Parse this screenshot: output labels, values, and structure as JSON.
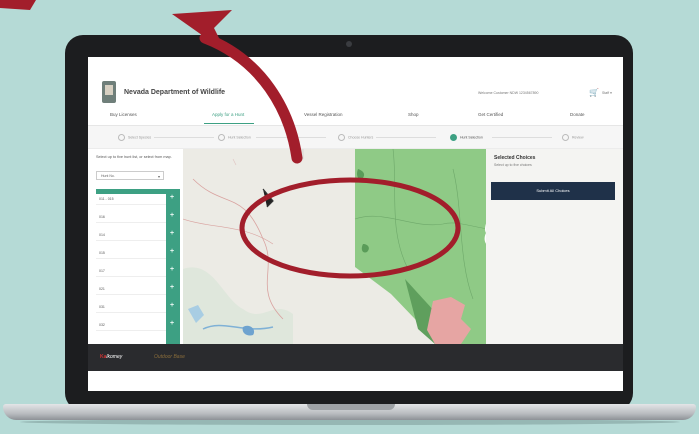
{
  "app": {
    "brand": "Nevada Department of Wildlife",
    "account_text": "Welcome Customer NDW 1234567890",
    "account_menu": "Staff ▾"
  },
  "nav": {
    "items": [
      "Buy Licenses",
      "Apply for a Hunt",
      "Vessel Registration",
      "Shop",
      "Get Certified",
      "Donate"
    ],
    "active_index": 1
  },
  "steps": [
    "Select Species",
    "Hunt Selection",
    "Choose Hunters",
    "Hunt Selection",
    "Review"
  ],
  "current_step": 3,
  "sidebar": {
    "note": "Select up to five hunt list, or select from map.",
    "select_value": "Hunt No.",
    "hunt_units": [
      "011 - 015",
      "016",
      "014",
      "015",
      "017",
      "021",
      "031",
      "032"
    ]
  },
  "panel": {
    "title": "Selected Choices",
    "subtitle": "Select up to five choices",
    "submit_label": "Submit All Choices"
  },
  "footer": {
    "logo_mark": "Ka",
    "logo_text": "lkomey",
    "tagline": "Outdoor Base"
  },
  "colors": {
    "brand_green": "#3da083",
    "annotation_red": "#a21e2b",
    "submit_navy": "#1f3149",
    "map_selected": "#8fca86"
  }
}
